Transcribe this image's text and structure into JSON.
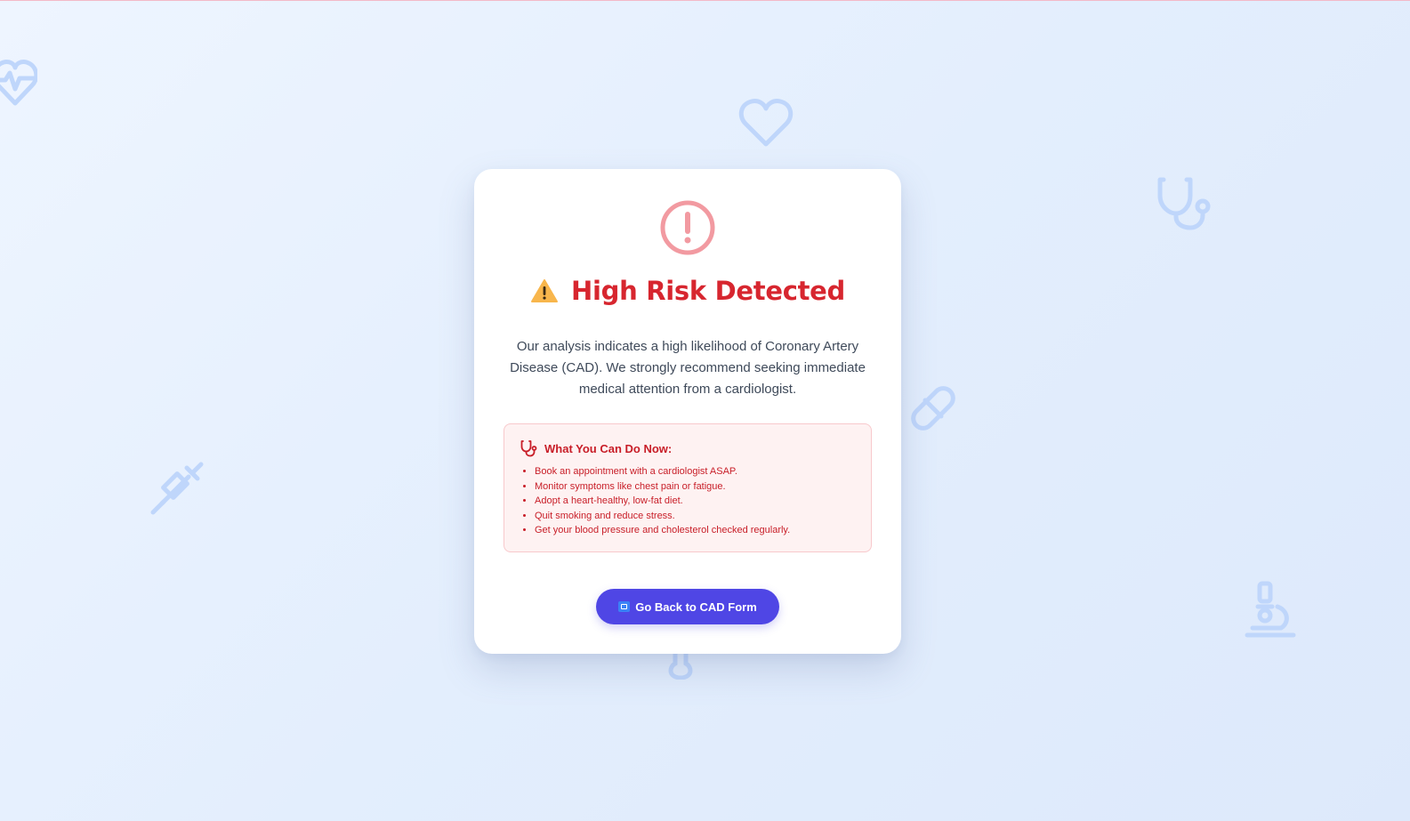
{
  "colors": {
    "title_red": "#d7262f",
    "advice_red": "#c81e28",
    "button_indigo": "#4f46e5",
    "background_icon_blue": "#bfd6fb"
  },
  "background_icons": [
    "heart-pulse-icon",
    "heart-icon",
    "stethoscope-icon",
    "pill-icon",
    "syringe-icon",
    "thermometer-icon",
    "microscope-icon"
  ],
  "result": {
    "status_icon": "alert-circle-icon",
    "title_icon": "warning-emoji",
    "title": "High Risk Detected",
    "description": "Our analysis indicates a high likelihood of Coronary Artery Disease (CAD). We strongly recommend seeking immediate medical attention from a cardiologist."
  },
  "advice": {
    "icon": "stethoscope-icon",
    "heading": "What You Can Do Now:",
    "items": [
      "Book an appointment with a cardiologist ASAP.",
      "Monitor symptoms like chest pain or fatigue.",
      "Adopt a heart-healthy, low-fat diet.",
      "Quit smoking and reduce stress.",
      "Get your blood pressure and cholesterol checked regularly."
    ]
  },
  "actions": {
    "back_icon": "repeat-icon",
    "back_label": "Go Back to CAD Form"
  }
}
